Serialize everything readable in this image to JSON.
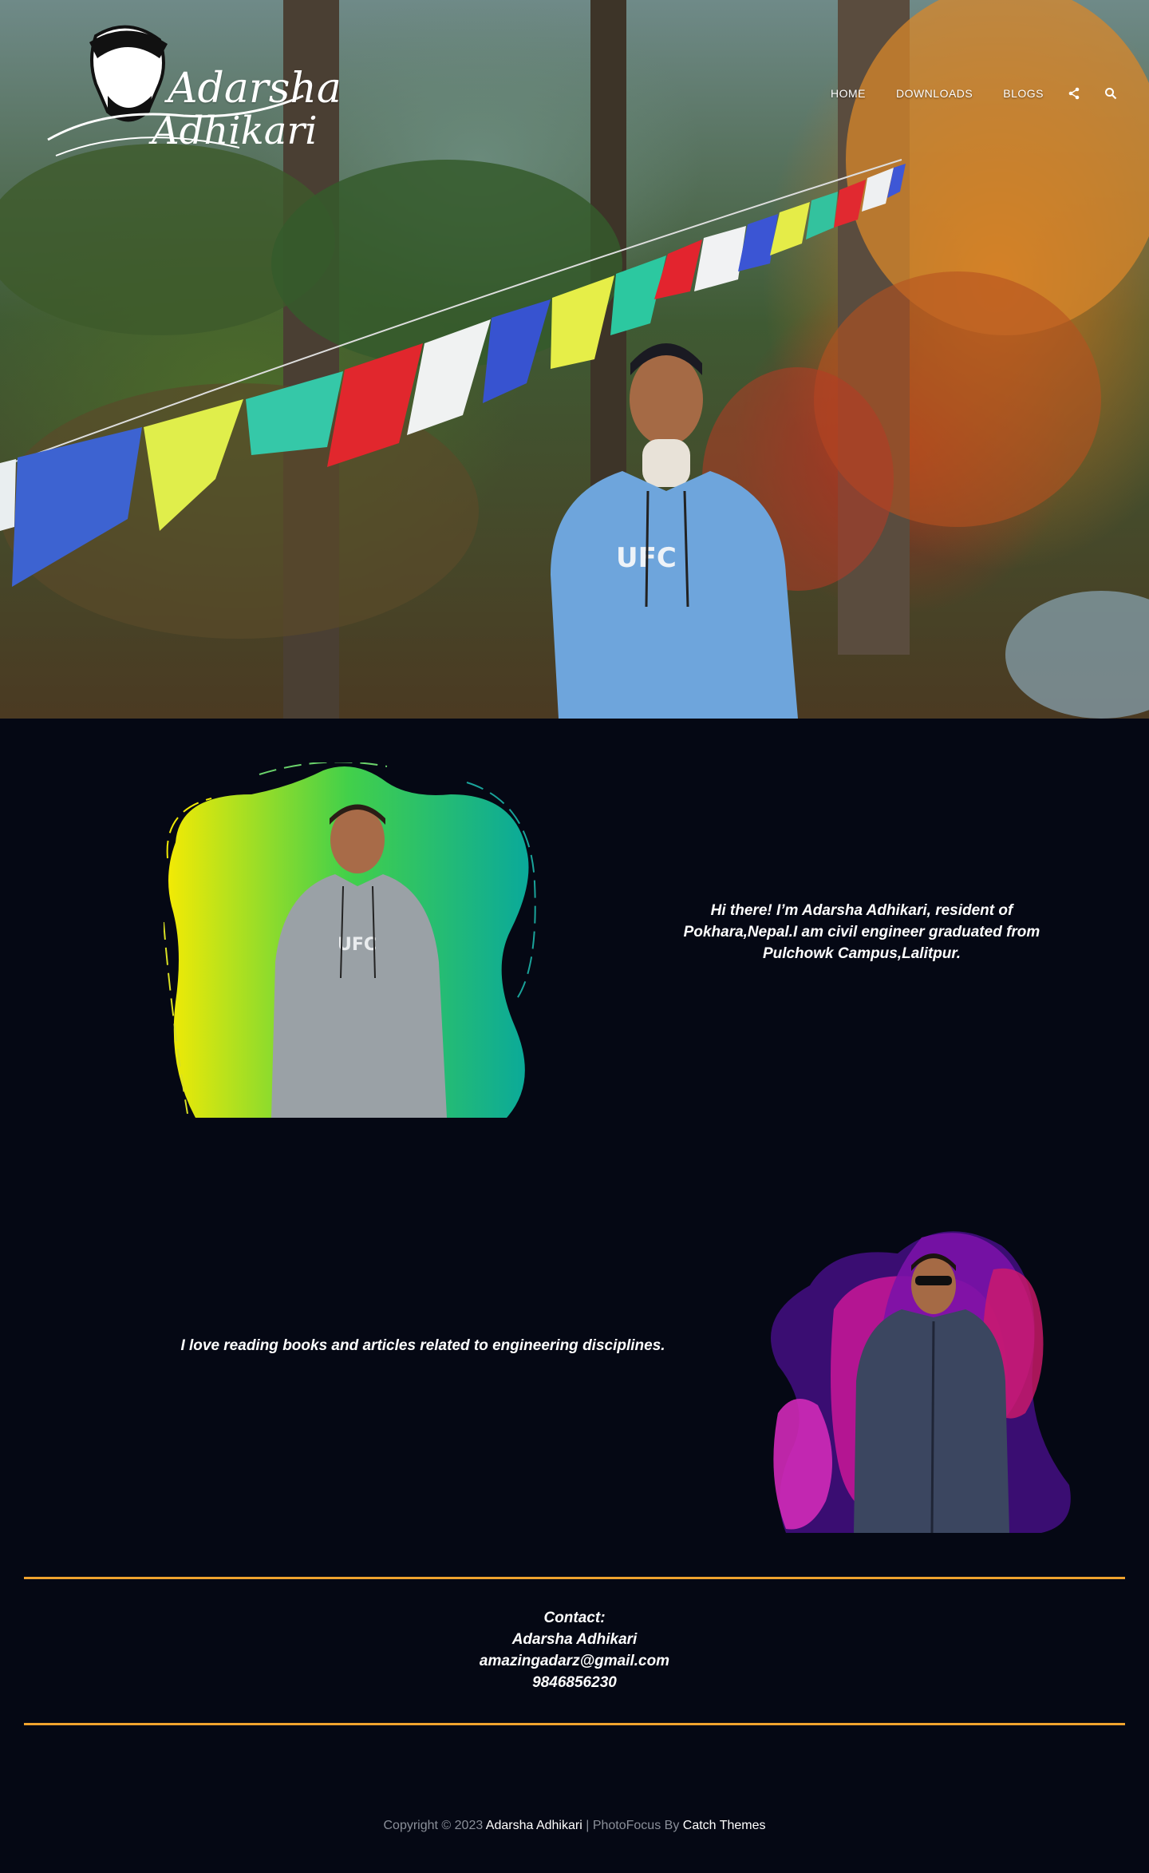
{
  "site": {
    "logo_line1": "Adarsha",
    "logo_line2": "Adhikari"
  },
  "nav": {
    "items": [
      {
        "label": "HOME"
      },
      {
        "label": "DOWNLOADS"
      },
      {
        "label": "BLOGS"
      }
    ],
    "share_icon": "share-icon",
    "search_icon": "search-icon"
  },
  "about": {
    "intro": "Hi there! I’m Adarsha Adhikari, resident of Pokhara,Nepal.I am civil engineer graduated from Pulchowk Campus,Lalitpur.",
    "hobby": "I love reading books and articles related to engineering disciplines."
  },
  "contact": {
    "heading": "Contact:",
    "name": "Adarsha Adhikari",
    "email": "amazingadarz@gmail.com",
    "phone": "9846856230"
  },
  "footer": {
    "prefix": "Copyright © 2023 ",
    "owner": "Adarsha Adhikari",
    "middle": " | PhotoFocus By ",
    "theme": "Catch Themes"
  },
  "colors": {
    "background": "#050814",
    "divider": "#f0a32e"
  }
}
